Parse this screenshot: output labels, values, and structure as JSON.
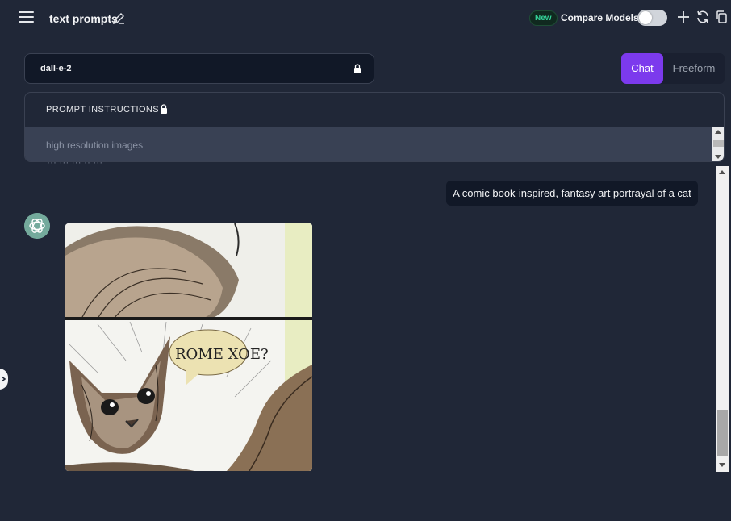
{
  "header": {
    "title": "text prompts",
    "badge": "New",
    "compare_label": "Compare Models",
    "compare_enabled": false
  },
  "model_select": {
    "value": "dall-e-2"
  },
  "mode_tabs": [
    {
      "label": "Chat",
      "active": true
    },
    {
      "label": "Freeform",
      "active": false
    }
  ],
  "instructions": {
    "label": "PROMPT INSTRUCTIONS",
    "text": "high resolution images"
  },
  "chat": {
    "user_message": "A comic book-inspired, fantasy art portrayal of a cat",
    "image_caption": "ROME XOE?"
  },
  "colors": {
    "accent": "#7c3aed",
    "background": "#202737",
    "badge_green": "#34d399"
  },
  "icons": [
    "menu-icon",
    "edit-icon",
    "plus-icon",
    "refresh-icon",
    "copy-icon",
    "lock-icon",
    "chatgpt-logo-icon",
    "chevron-right-icon"
  ]
}
